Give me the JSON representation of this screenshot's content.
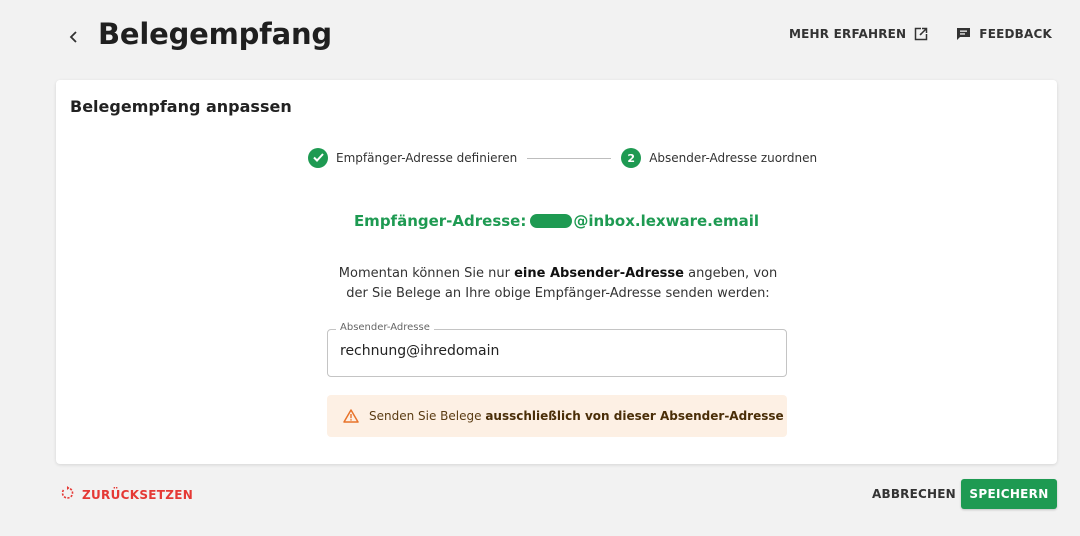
{
  "header": {
    "back_icon": "chevron-left-icon",
    "title": "Belegempfang",
    "learn_more_label": "MEHR ERFAHREN",
    "learn_more_icon": "external-link-icon",
    "feedback_icon": "feedback-icon",
    "feedback_label": "FEEDBACK"
  },
  "card": {
    "title": "Belegempfang anpassen",
    "stepper": {
      "steps": [
        {
          "number": "1",
          "label": "Empfänger-Adresse definieren",
          "state": "completed",
          "icon": "check-icon"
        },
        {
          "number": "2",
          "label": "Absender-Adresse zuordnen",
          "state": "active"
        }
      ]
    },
    "recipient": {
      "label": "Empfänger-Adresse:",
      "domain": "@inbox.lexware.email"
    },
    "info": {
      "part1": "Momentan können Sie nur ",
      "bold": "eine Absender-Adresse",
      "part2": " angeben, von der Sie Belege an Ihre obige Empfänger-Adresse senden werden:"
    },
    "sender_field": {
      "label": "Absender-Adresse",
      "value": "rechnung@ihredomain"
    },
    "warning": {
      "icon": "warning-icon",
      "text": "Senden Sie Belege ",
      "bold": "ausschließlich von dieser Absender-Adresse"
    }
  },
  "footer": {
    "reset_icon": "reset-icon",
    "reset_label": "ZURÜCKSETZEN",
    "cancel_label": "ABBRECHEN",
    "save_label": "SPEICHERN"
  },
  "colors": {
    "accent": "#1e9a52",
    "danger": "#e53935",
    "warning_bg": "#fdf0e4",
    "warning_icon": "#e8732a"
  }
}
